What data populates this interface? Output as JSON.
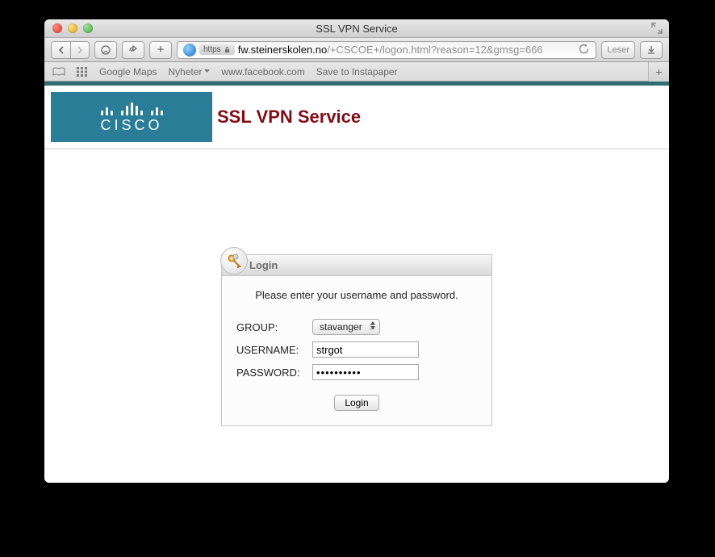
{
  "window": {
    "title": "SSL VPN Service"
  },
  "toolbar": {
    "https_label": "https",
    "url_host": "fw.steinerskolen.no",
    "url_path": "/+CSCOE+/logon.html?reason=12&gmsg=666",
    "reader_label": "Leser"
  },
  "bookmarks": {
    "items": [
      "Google Maps",
      "Nyheter",
      "www.facebook.com",
      "Save to Instapaper"
    ]
  },
  "page": {
    "brand": "CISCO",
    "title": "SSL VPN Service"
  },
  "login": {
    "header": "Login",
    "prompt": "Please enter your username and password.",
    "group_label": "GROUP:",
    "group_value": "stavanger",
    "user_label": "USERNAME:",
    "user_value": "strgot",
    "pass_label": "PASSWORD:",
    "pass_value": "••••••••••",
    "button": "Login"
  }
}
